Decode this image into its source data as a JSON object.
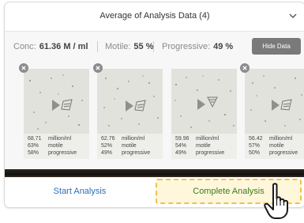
{
  "dialog": {
    "title": "Average of Analysis Data (4)"
  },
  "summary": {
    "conc_label": "Conc:",
    "conc_value": "61.36 M / ml",
    "motile_label": "Motile:",
    "motile_value": "55 %",
    "progressive_label": "Progressive:",
    "progressive_value": "49 %",
    "hide_button": "Hide Data"
  },
  "samples": [
    {
      "conc": "68.71",
      "conc_unit": "million/ml",
      "motile": "63%",
      "motile_label": "motile",
      "progressive": "58%",
      "progressive_label": "progressive"
    },
    {
      "conc": "62.76",
      "conc_unit": "million/ml",
      "motile": "52%",
      "motile_label": "motile",
      "progressive": "49%",
      "progressive_label": "progressive"
    },
    {
      "conc": "59.96",
      "conc_unit": "million/ml",
      "motile": "54%",
      "motile_label": "motile",
      "progressive": "49%",
      "progressive_label": "progressive"
    },
    {
      "conc": "56.42",
      "conc_unit": "million/ml",
      "motile": "57%",
      "motile_label": "motile",
      "progressive": "50%",
      "progressive_label": "progressive"
    }
  ],
  "actions": {
    "start": "Start Analysis",
    "complete": "Complete Analysis"
  },
  "colors": {
    "start_text": "#2d6fb8",
    "complete_text": "#3a7d17",
    "complete_highlight_border": "#f0c244",
    "hide_button_bg": "#7a7a7a"
  },
  "icons": [
    "chevron-down-icon",
    "close-icon",
    "play-icon",
    "layers-icon",
    "hand-pointer-cursor"
  ]
}
